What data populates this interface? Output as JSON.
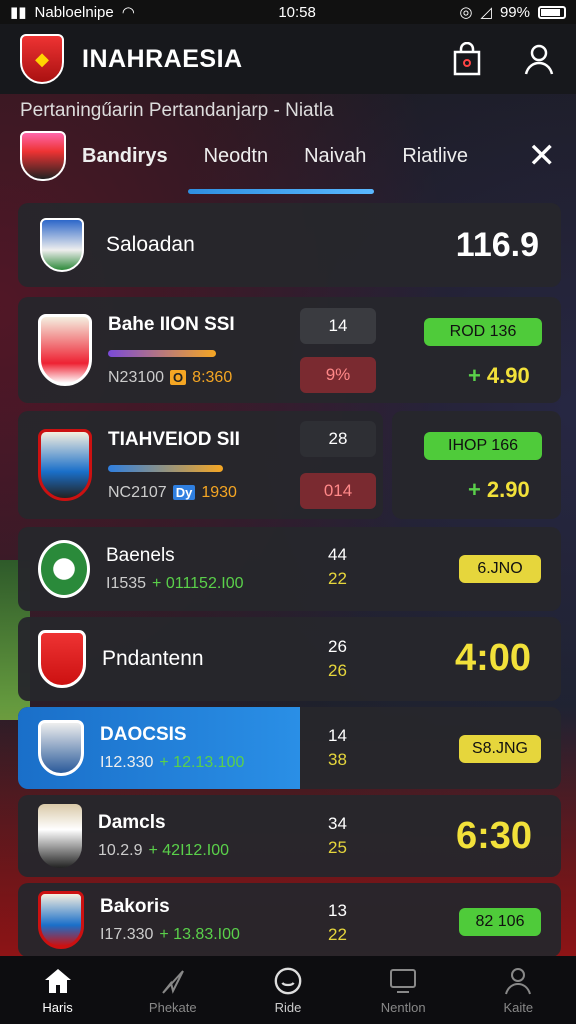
{
  "status_bar": {
    "left": "Nabloelnipe",
    "time": "10:58",
    "battery": "99%"
  },
  "header": {
    "title": "INAHRAESIA"
  },
  "subtitle": "Pertaningűarin Pertandanjarp - Niatla",
  "tabs": [
    {
      "label": "Bandirys"
    },
    {
      "label": "Neodtn"
    },
    {
      "label": "Naivah"
    },
    {
      "label": "Riatlive"
    }
  ],
  "summary": {
    "name": "Saloadan",
    "value": "116.9"
  },
  "matches": [
    {
      "name": "Bahe IION SSI",
      "meta_a": "N23100",
      "tag": "O",
      "meta_b": "8:360",
      "box_top": "14",
      "box_bottom": "9%",
      "odds_btn": "ROD 136",
      "odds": "4.90"
    },
    {
      "name": "TIAHVEIOD SII",
      "meta_a": "NC2107",
      "tag": "Dy",
      "meta_b": "1930",
      "box_top": "28",
      "box_bottom": "014",
      "odds_btn": "IHOP 166",
      "odds": "2.90"
    }
  ],
  "rows": [
    {
      "name": "Baenels",
      "meta": "I1535",
      "delta": "+ 011152.I00",
      "n1": "44",
      "n2": "22",
      "odds": "6.JNO"
    },
    {
      "name": "Pndantenn",
      "n1": "26",
      "n2": "26",
      "odds": "4:00"
    },
    {
      "name": "DAOCSIS",
      "meta": "I12.330",
      "delta": "+ 12.13.100",
      "n1": "14",
      "n2": "38",
      "odds": "S8.JNG"
    },
    {
      "name": "Damcls",
      "meta": "10.2.9",
      "delta": "+ 42I12.I00",
      "n1": "34",
      "n2": "25",
      "odds": "6:30"
    },
    {
      "name": "Bakoris",
      "meta": "I17.330",
      "delta": "+ 13.83.I00",
      "n1": "13",
      "n2": "22",
      "odds": "82 106"
    }
  ],
  "nav": [
    {
      "label": "Haris"
    },
    {
      "label": "Phekate"
    },
    {
      "label": "Ride"
    },
    {
      "label": "Nentlon"
    },
    {
      "label": "Kaite"
    }
  ],
  "colors": {
    "accent_blue": "#2f8fe0",
    "green": "#5ad04a",
    "yellow": "#f2e13a",
    "red_box": "#8a2a30"
  }
}
